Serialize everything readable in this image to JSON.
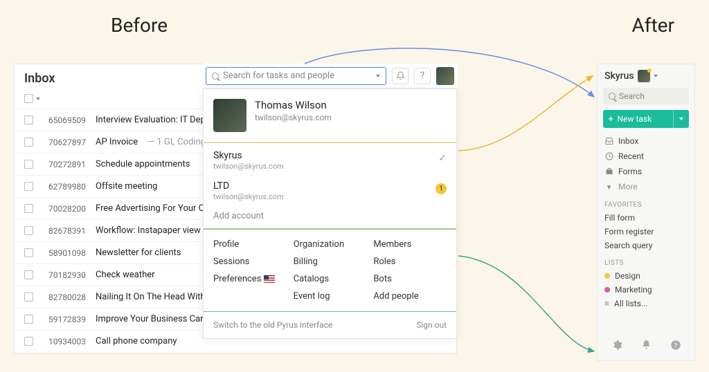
{
  "labels": {
    "before": "Before",
    "after": "After"
  },
  "before": {
    "inbox_title": "Inbox",
    "search_placeholder": "Search for tasks and people",
    "tasks": [
      {
        "id": "65069509",
        "title": "Interview Evaluation: IT Department, I"
      },
      {
        "id": "70627897",
        "title": "AP Invoice",
        "sub": "— 1 GL Coding"
      },
      {
        "id": "70272891",
        "title": "Schedule appointments"
      },
      {
        "id": "62789980",
        "title": "Offsite meeting"
      },
      {
        "id": "70028200",
        "title": "Free Advertising For Your Online Busine"
      },
      {
        "id": "82678391",
        "title": "Workflow: Instapaper view to PDF"
      },
      {
        "id": "58901098",
        "title": "Newsletter for clients"
      },
      {
        "id": "70182930",
        "title": "Check weather"
      },
      {
        "id": "82780028",
        "title": "Nailing It On The Head With Free Interne"
      },
      {
        "id": "59172839",
        "title": "Improve Your Business Cards And Enha"
      },
      {
        "id": "10934003",
        "title": "Call phone company"
      }
    ]
  },
  "dropdown": {
    "user": {
      "name": "Thomas Wilson",
      "email": "twilson@skyrus.com"
    },
    "accounts": [
      {
        "name": "Skyrus",
        "email": "twilson@skyrus.com",
        "selected": true
      },
      {
        "name": "LTD",
        "email": "twilson@skyrus.com",
        "badge": "1"
      }
    ],
    "add_account": "Add account",
    "links_col1": [
      "Profile",
      "Sessions",
      "Preferences"
    ],
    "links_col2": [
      "Organization",
      "Billing",
      "Catalogs",
      "Event log"
    ],
    "links_col3": [
      "Members",
      "Roles",
      "Bots",
      "Add people"
    ],
    "footer_left": "Switch to the old Pyrus interface",
    "footer_right": "Sign out"
  },
  "after": {
    "org": "Skyrus",
    "search": "Search",
    "new_task": "New task",
    "nav": [
      {
        "icon": "inbox-icon",
        "label": "Inbox"
      },
      {
        "icon": "clock-icon",
        "label": "Recent"
      },
      {
        "icon": "briefcase-icon",
        "label": "Forms"
      },
      {
        "icon": "caret-icon",
        "label": "More"
      }
    ],
    "favorites_title": "FAVORITES",
    "favorites": [
      "Fill form",
      "Form register",
      "Search query"
    ],
    "lists_title": "LISTS",
    "lists": [
      {
        "color": "#f2c83a",
        "label": "Design"
      },
      {
        "color": "#d85aa8",
        "label": "Marketing"
      }
    ],
    "all_lists": "All lists..."
  }
}
